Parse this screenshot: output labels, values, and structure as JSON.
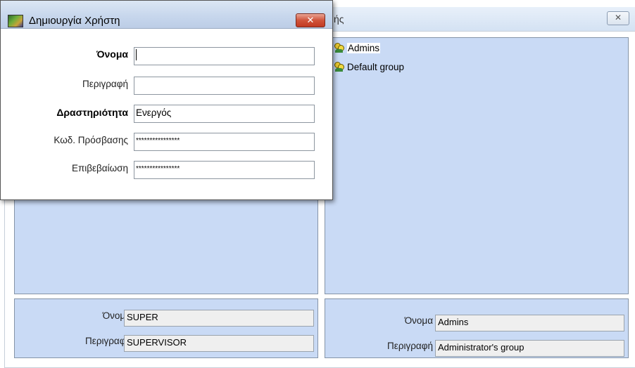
{
  "main_window": {
    "title_fragment": "ής",
    "close_glyph": "✕"
  },
  "groups_list": {
    "items": [
      {
        "label": "Admins",
        "selected": true
      },
      {
        "label": "Default group",
        "selected": false
      }
    ]
  },
  "user_details": {
    "name_label": "Όνομα",
    "name_value": "SUPER",
    "description_label": "Περιγραφή",
    "description_value": "SUPERVISOR"
  },
  "group_details": {
    "name_label": "Όνομα",
    "name_value": "Admins",
    "description_label": "Περιγραφή",
    "description_value": "Administrator's group"
  },
  "dialog": {
    "title": "Δημιουργία Χρήστη",
    "close_glyph": "✕",
    "fields": {
      "name_label": "Όνομα",
      "name_value": "",
      "description_label": "Περιγραφή",
      "description_value": "",
      "activity_label": "Δραστηριότητα",
      "activity_value": "Ενεργός",
      "password_label": "Κωδ. Πρόσβασης",
      "password_value": "****************",
      "confirm_label": "Επιβεβαίωση",
      "confirm_value": "****************"
    }
  }
}
